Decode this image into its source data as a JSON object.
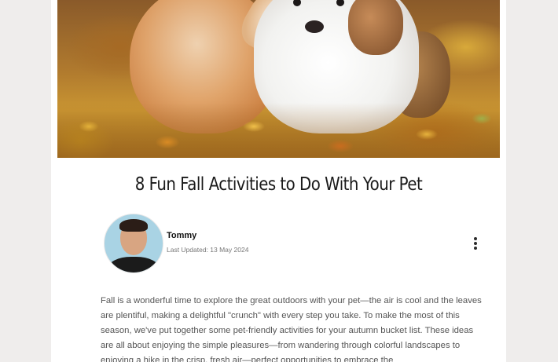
{
  "article": {
    "title": "8 Fun Fall Activities to Do With Your Pet",
    "hero_alt": "cat and dog in autumn leaves",
    "author": {
      "name": "Tommy",
      "updated": "Last Updated: 13 May 2024"
    },
    "menu_icon": "more-vertical-icon",
    "intro": "Fall is a wonderful time to explore the great outdoors with your pet—the air is cool and the leaves are plentiful, making a delightful \"crunch\" with every step you take. To make the most of this season, we've put together some pet-friendly activities for your autumn bucket list. These ideas are all about enjoying the simple pleasures—from wandering through colorful landscapes to enjoying a hike in the crisp, fresh air—perfect opportunities to embrace the"
  },
  "colors": {
    "page_bg": "#efedec",
    "card_bg": "#ffffff",
    "title": "#1a1a1a",
    "body_text": "#555555"
  }
}
